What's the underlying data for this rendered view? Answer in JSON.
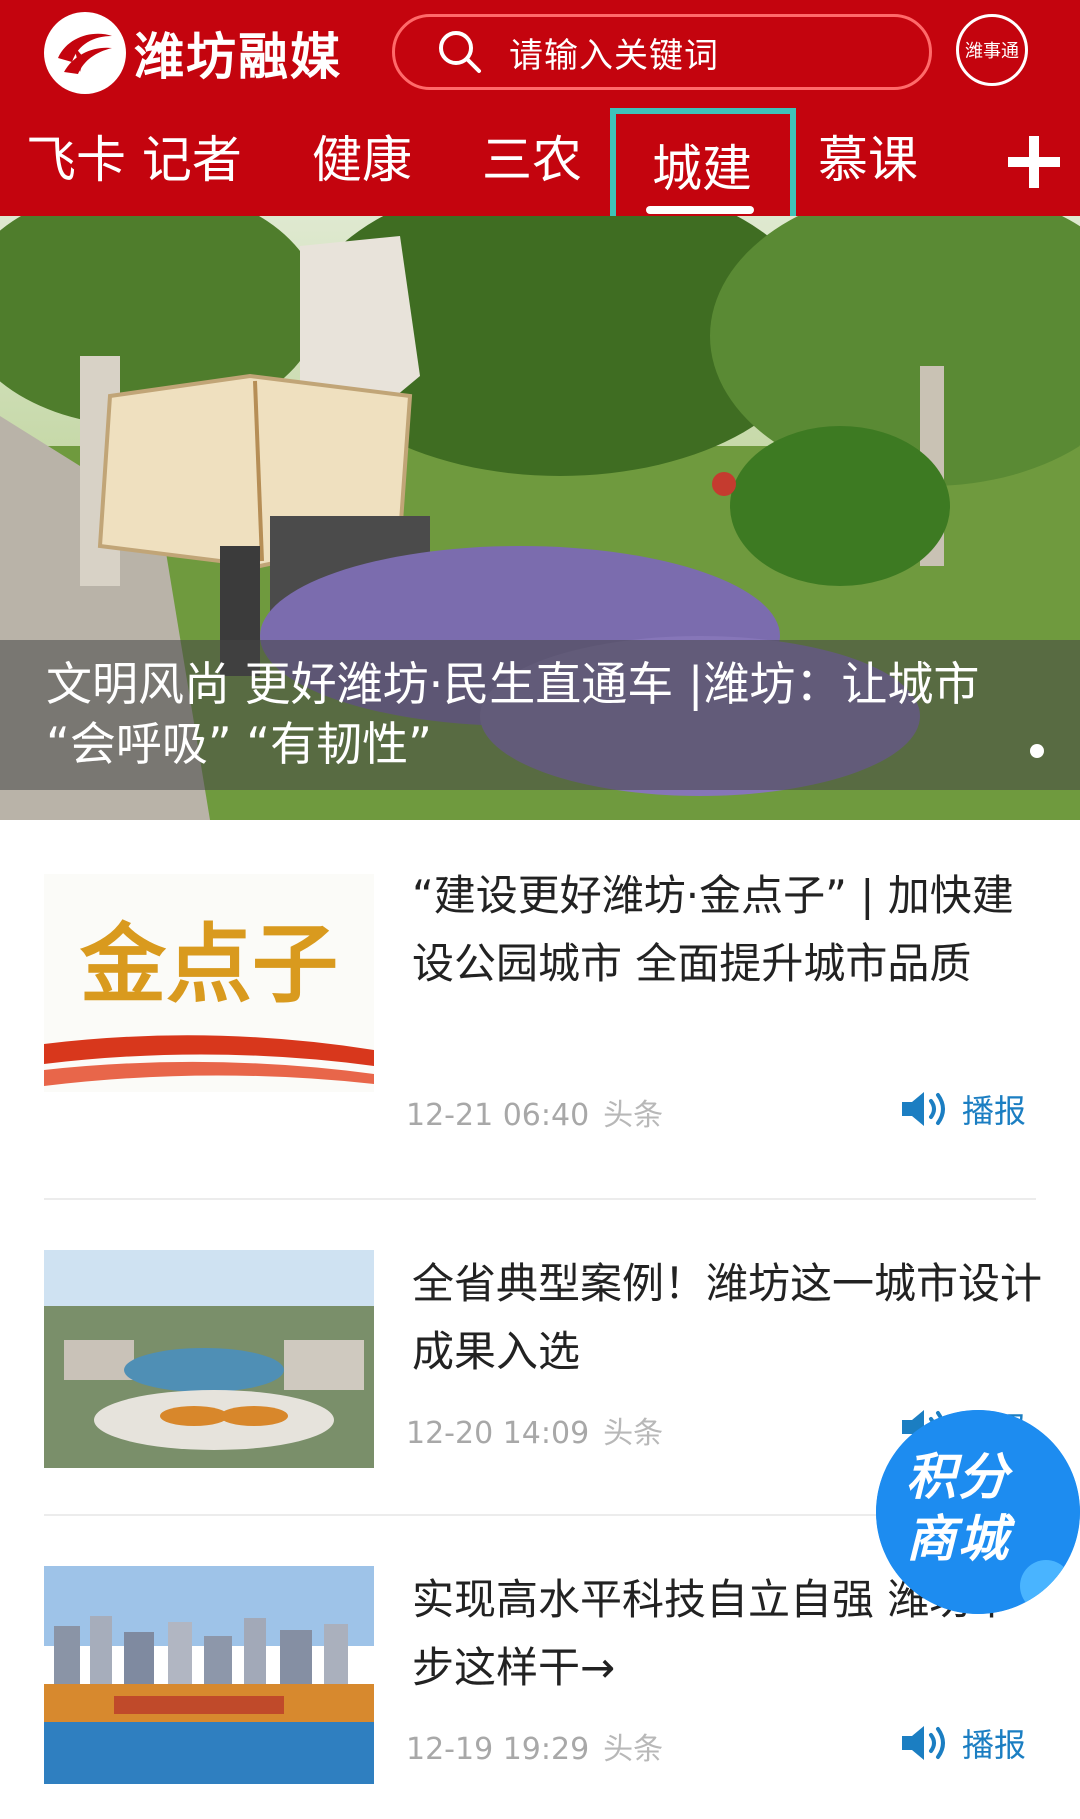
{
  "header": {
    "logo_text": "潍坊融媒",
    "search_placeholder": "请输入关键词",
    "badge_label": "潍事通"
  },
  "tabs": [
    {
      "label": "飞卡 记者"
    },
    {
      "label": "健康"
    },
    {
      "label": "三农"
    },
    {
      "label": "城建",
      "active": true
    },
    {
      "label": "慕课"
    }
  ],
  "hero": {
    "title": "文明风尚 更好潍坊·民生直通车 |潍坊：让城市 “会呼吸” “有韧性”"
  },
  "news": [
    {
      "title": "“建设更好潍坊·金点子” | 加快建设公园城市 全面提升城市品质",
      "date": "12-21 06:40",
      "source": "头条",
      "broadcast_label": "播报",
      "thumb_text": "金点子"
    },
    {
      "title": "全省典型案例！潍坊这一城市设计成果入选",
      "date": "12-20 14:09",
      "source": "头条",
      "broadcast_label": "播报"
    },
    {
      "title": "实现高水平科技自立自强 潍坊下步这样干→",
      "date": "12-19 19:29",
      "source": "头条",
      "broadcast_label": "播报"
    }
  ],
  "floating": {
    "label_line1": "积分",
    "label_line2": "商城"
  },
  "colors": {
    "header_red": "#c4040e",
    "highlight_teal": "#3fc3b9",
    "broadcast_blue": "#1b7ec2",
    "mall_blue": "#1d8cf0"
  }
}
